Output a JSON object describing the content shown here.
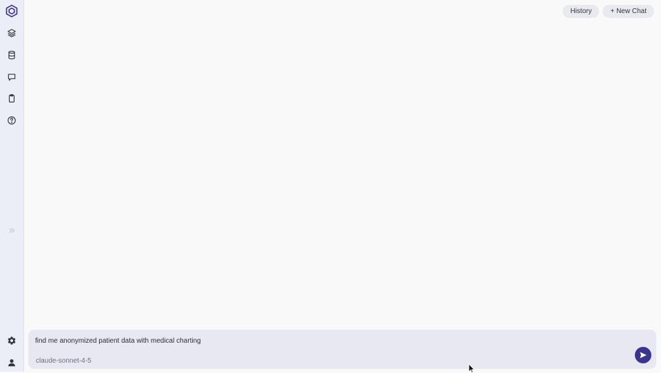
{
  "header": {
    "history_label": "History",
    "new_chat_label": "+ New Chat"
  },
  "sidebar": {
    "items": [
      {
        "icon": "layers-icon"
      },
      {
        "icon": "database-icon"
      },
      {
        "icon": "chat-bubble-icon"
      },
      {
        "icon": "clipboard-icon"
      },
      {
        "icon": "help-circle-icon"
      }
    ],
    "bottom": [
      {
        "icon": "gear-icon"
      },
      {
        "icon": "user-icon"
      }
    ]
  },
  "composer": {
    "input_value": "find me anonymized patient data with medical charting",
    "model": "claude-sonnet-4-5"
  },
  "colors": {
    "accent": "#3b348c",
    "sidebar_bg": "#eceef7",
    "composer_bg": "#e7e8f2",
    "page_bg": "#f9f9fa"
  }
}
